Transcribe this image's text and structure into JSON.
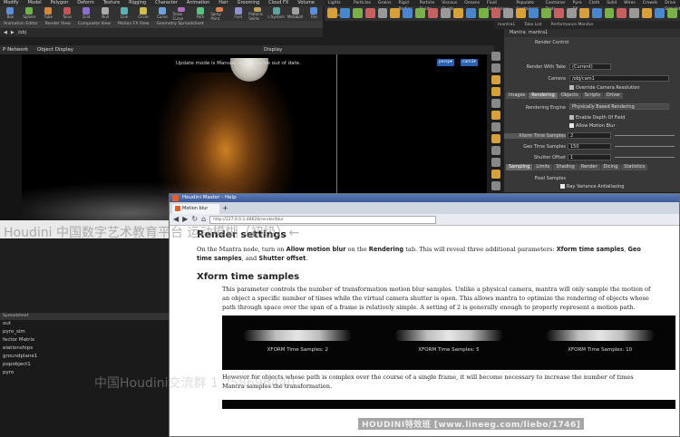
{
  "menubar": [
    "Modify",
    "Model",
    "Polygon",
    "Deform",
    "Texture",
    "Rigging",
    "Character",
    "Animation",
    "Hair",
    "Grooming",
    "Cloud FX",
    "Volume"
  ],
  "shelf_tools": [
    "Box",
    "Sphere",
    "Tube",
    "Torus",
    "Grid",
    "Null",
    "Line",
    "Circle",
    "Curve",
    "Draw Curve",
    "Path",
    "Spray Paint",
    "Font",
    "Platonic Solids",
    "L-System",
    "Metaball",
    "File"
  ],
  "right_shelf_tabs": [
    "Lights and Cameras",
    "Particles",
    "Grains",
    "Rigid Bodies",
    "Particle Fluids",
    "Viscous Fluids",
    "Oceans",
    "Fluid Containers",
    "Populate Containers",
    "Container Tools",
    "Pyro FX",
    "Cloth",
    "Solid",
    "Wires",
    "Crowds",
    "Drive Simulation"
  ],
  "panel_tabs": [
    "Animation Editor",
    "Render View",
    "Composite View",
    "Motion FX View",
    "Geometry Spreadsheet"
  ],
  "path": "/obj",
  "network_bar": {
    "network": "P Network",
    "object_display": "Object Display",
    "display": "Display"
  },
  "viewport": {
    "message": "Update mode is Manual. View may be out of date.",
    "persp": "persp▾",
    "cam": "cam1▾"
  },
  "param_tabs": [
    "mantra1",
    "Take List",
    "Performance Monitor"
  ],
  "mantra": {
    "node_type": "Mantra",
    "node_name": "mantra1",
    "top_label": "Render Control",
    "render_with_take_label": "Render With Take",
    "render_with_take": "(Current)",
    "camera_label": "Camera",
    "camera": "/obj/cam1",
    "override_label": "Override Camera Resolution",
    "tabs1": [
      "Images",
      "Rendering",
      "Objects",
      "Scripts",
      "Driver"
    ],
    "engine_label": "Rendering Engine",
    "engine": "Physically Based Rendering",
    "dof": "Enable Depth Of Field",
    "allow_mb": "Allow Motion Blur",
    "xform_label": "Xform Time Samples",
    "xform_value": "2",
    "geo_label": "Geo Time Samples",
    "geo_value": "150",
    "shutter_label": "Shutter Offset",
    "shutter_value": "1",
    "tabs2": [
      "Sampling",
      "Limits",
      "Shading",
      "Render",
      "Dicing",
      "Statistics"
    ],
    "pixel_label": "Pixel Samples",
    "ray_aa": "Ray Variance Antialiasing"
  },
  "spreadsheet": {
    "header": "Spreadsheet",
    "rows": [
      "out",
      "pyro_sim",
      "fector Matrix",
      "elationships",
      "groundplane1",
      "popobject1",
      "pyro"
    ]
  },
  "browser": {
    "window_title": "Houdini Master - Help",
    "tab_label": "Motion blur",
    "url": "http://127.0.0.1:48626/render/blur",
    "section_title": "Render settings",
    "intro_pre": "On the Mantra node, turn on ",
    "intro_b1": "Allow motion blur",
    "intro_mid": " on the ",
    "intro_b2": "Rendering",
    "intro_mid2": " tab. This will reveal three additional parameters: ",
    "intro_b3": "Xform time samples",
    "intro_mid3": ", ",
    "intro_b4": "Geo time samples",
    "intro_mid4": ", and ",
    "intro_b5": "Shutter offset",
    "intro_end": ".",
    "heading": "Xform time samples",
    "para1": "This parameter controls the number of transformation motion blur samples. Unlike a physical camera, mantra will only sample the motion of an object a specific number of times while the virtual camera shutter is open. This allows mantra to optimize the rendering of objects whose path through space over the span of a frame is relatively simple. A setting of 2 is generally enough to properly represent a motion path.",
    "samples": [
      "XFORM Time Samples: 2",
      "XFORM Time Samples: 5",
      "XFORM Time Samples: 10"
    ],
    "para2": "However for objects whose path is complex over the course of a single frame, it will become necessary to increase the number of times Mantra samples the transformation."
  },
  "watermarks": {
    "top": "Houdini 中国数字艺术教育平台 运动模糊（初级）←",
    "middle": "中国Houdini交流群 1 258696440",
    "bottom": "HOUDINI特效班  [www.lineeg.com/liebo/1746]"
  }
}
